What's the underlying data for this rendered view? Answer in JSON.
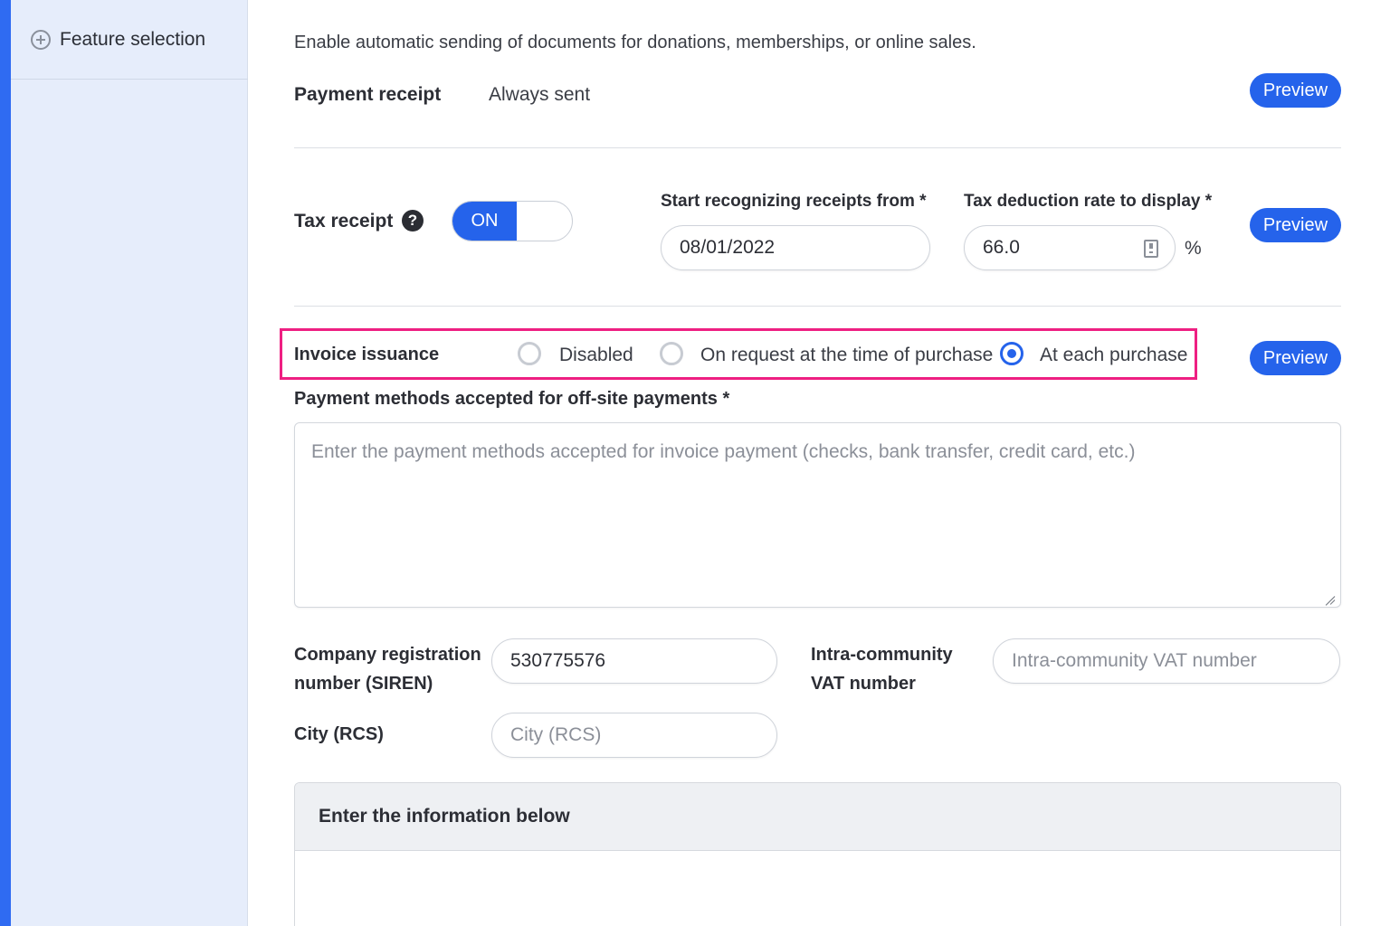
{
  "sidebar": {
    "items": [
      {
        "label": "Feature selection",
        "icon": "plus-circle-icon"
      }
    ]
  },
  "intro_text": "Enable automatic sending of documents for donations, memberships, or online sales.",
  "payment_receipt": {
    "label": "Payment receipt",
    "status": "Always sent",
    "preview_label": "Preview"
  },
  "tax_receipt": {
    "label": "Tax receipt",
    "help_glyph": "?",
    "toggle_label": "ON",
    "start_label": "Start recognizing receipts from *",
    "start_value": "08/01/2022",
    "rate_label": "Tax deduction rate to display *",
    "rate_value": "66.0",
    "rate_unit": "%",
    "preview_label": "Preview"
  },
  "invoice": {
    "label": "Invoice issuance",
    "options": [
      "Disabled",
      "On request at the time of purchase",
      "At each purchase"
    ],
    "selected": "At each purchase",
    "preview_label": "Preview",
    "payment_methods_label": "Payment methods accepted for off-site payments *",
    "payment_methods_placeholder": "Enter the payment methods accepted for invoice payment (checks, bank transfer, credit card, etc.)"
  },
  "company": {
    "siren_label_1": "Company registration",
    "siren_label_2": "number (SIREN)",
    "siren_value": "530775576",
    "vat_label_1": "Intra-community",
    "vat_label_2": "VAT number",
    "vat_placeholder": "Intra-community VAT number",
    "rcs_label": "City (RCS)",
    "rcs_placeholder": "City (RCS)"
  },
  "info_panel": {
    "title": "Enter the information below"
  },
  "colors": {
    "accent": "#2563eb",
    "highlight": "#ee1f82",
    "sidebar_bg": "#e6edfb"
  }
}
